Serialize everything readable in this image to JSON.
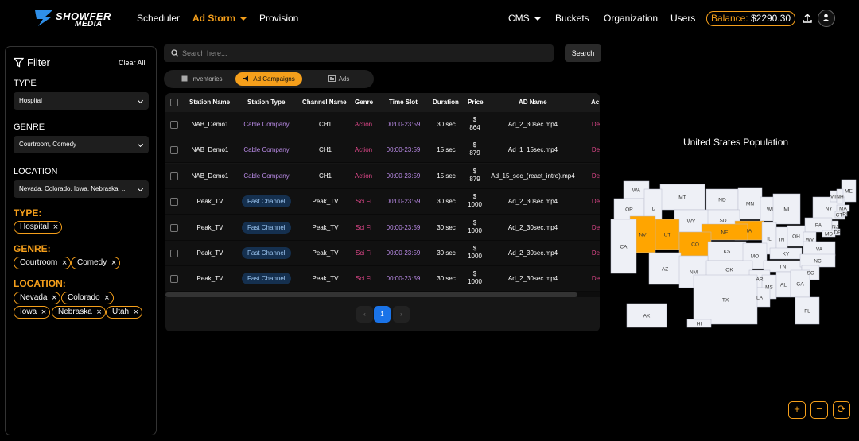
{
  "brand": {
    "name": "SHOWFER",
    "sub": "MEDIA"
  },
  "nav": {
    "scheduler": "Scheduler",
    "ad_storm": "Ad Storm",
    "provision": "Provision",
    "cms": "CMS",
    "buckets": "Buckets",
    "organization": "Organization",
    "users": "Users",
    "balance_label": "Balance:",
    "balance_value": "$2290.30"
  },
  "filter": {
    "title": "Filter",
    "clear_all": "Clear All",
    "type_label": "TYPE",
    "type_value": "Hospital",
    "genre_label": "GENRE",
    "genre_value": "Courtroom, Comedy",
    "location_label": "LOCATION",
    "location_value": "Nevada, Colorado, Iowa, Nebraska, ...",
    "type_title": "TYPE:",
    "genre_title": "GENRE:",
    "location_title": "LOCATION:",
    "type_chips": [
      "Hospital"
    ],
    "genre_chips": [
      "Courtroom",
      "Comedy"
    ],
    "location_chips": [
      "Nevada",
      "Colorado",
      "Iowa",
      "Nebraska",
      "Utah"
    ]
  },
  "search": {
    "placeholder": "Search here...",
    "button": "Search"
  },
  "tabs": [
    "Inventories",
    "Ad Campaigns",
    "Ads"
  ],
  "table": {
    "headers": [
      "Station Name",
      "Station Type",
      "Channel Name",
      "Genre",
      "Time Slot",
      "Duration",
      "Price",
      "AD Name",
      "Ac"
    ],
    "rows": [
      {
        "station": "NAB_Demo1",
        "type": "Cable Company",
        "channel": "CH1",
        "genre": "Action",
        "slot": "00:00-23:59",
        "duration": "30 sec",
        "price_sym": "$",
        "price": "864",
        "ad": "Ad_2_30sec.mp4",
        "act": "De"
      },
      {
        "station": "NAB_Demo1",
        "type": "Cable Company",
        "channel": "CH1",
        "genre": "Action",
        "slot": "00:00-23:59",
        "duration": "15 sec",
        "price_sym": "$",
        "price": "879",
        "ad": "Ad_1_15sec.mp4",
        "act": "De"
      },
      {
        "station": "NAB_Demo1",
        "type": "Cable Company",
        "channel": "CH1",
        "genre": "Action",
        "slot": "00:00-23:59",
        "duration": "15 sec",
        "price_sym": "$",
        "price": "879",
        "ad": "Ad_15_sec_(react_intro).mp4",
        "act": "De"
      },
      {
        "station": "Peak_TV",
        "type": "Fast Channel",
        "channel": "Peak_TV",
        "genre": "Sci Fi",
        "slot": "00:00-23:59",
        "duration": "30 sec",
        "price_sym": "$",
        "price": "1000",
        "ad": "Ad_2_30sec.mp4",
        "act": "De"
      },
      {
        "station": "Peak_TV",
        "type": "Fast Channel",
        "channel": "Peak_TV",
        "genre": "Sci Fi",
        "slot": "00:00-23:59",
        "duration": "30 sec",
        "price_sym": "$",
        "price": "1000",
        "ad": "Ad_2_30sec.mp4",
        "act": "De"
      },
      {
        "station": "Peak_TV",
        "type": "Fast Channel",
        "channel": "Peak_TV",
        "genre": "Sci Fi",
        "slot": "00:00-23:59",
        "duration": "30 sec",
        "price_sym": "$",
        "price": "1000",
        "ad": "Ad_2_30sec.mp4",
        "act": "De"
      },
      {
        "station": "Peak_TV",
        "type": "Fast Channel",
        "channel": "Peak_TV",
        "genre": "Sci Fi",
        "slot": "00:00-23:59",
        "duration": "30 sec",
        "price_sym": "$",
        "price": "1000",
        "ad": "Ad_2_30sec.mp4",
        "act": "De"
      }
    ]
  },
  "pagination": {
    "prev": "‹",
    "current": "1",
    "next": "›"
  },
  "map": {
    "title": "United States Population",
    "highlight_color": "#ffa500",
    "base_color": "#eef0f6",
    "states": [
      "WA",
      "MT",
      "ND",
      "MN",
      "ME",
      "OR",
      "ID",
      "SD",
      "WI",
      "MI",
      "NY",
      "VT",
      "NH",
      "WY",
      "IA",
      "NE",
      "PA",
      "MA",
      "CT",
      "RI",
      "NV",
      "UT",
      "IL",
      "IN",
      "OH",
      "NJ",
      "DE",
      "MD",
      "CA",
      "CO",
      "KS",
      "MO",
      "WV",
      "VA",
      "KY",
      "TN",
      "NC",
      "AZ",
      "NM",
      "OK",
      "AR",
      "SC",
      "MS",
      "AL",
      "GA",
      "LA",
      "TX",
      "FL",
      "AK",
      "HI"
    ],
    "highlighted": [
      "NV",
      "UT",
      "CO",
      "NE",
      "IA"
    ]
  },
  "zoom": {
    "in": "+",
    "out": "−",
    "reset": "⟳"
  },
  "colors": {
    "accent": "#f59f1b",
    "genre_action": "#e0478a",
    "genre_scifi": "#e0478a",
    "time_slot": "#b98ae6",
    "cable": "#b98ae6",
    "delete": "#e0478a"
  }
}
